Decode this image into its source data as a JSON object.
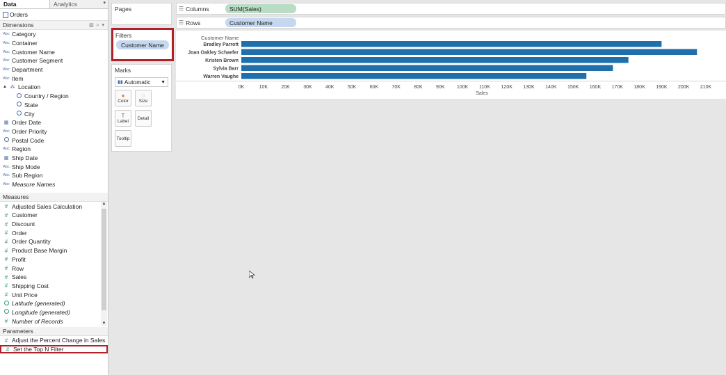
{
  "data_pane": {
    "tabs": [
      "Data",
      "Analytics"
    ],
    "datasource": "Orders",
    "dimensions_header": "Dimensions",
    "dimensions": [
      {
        "label": "Category",
        "type": "abc"
      },
      {
        "label": "Container",
        "type": "abc"
      },
      {
        "label": "Customer Name",
        "type": "abc"
      },
      {
        "label": "Customer Segment",
        "type": "abc"
      },
      {
        "label": "Department",
        "type": "abc"
      },
      {
        "label": "Item",
        "type": "abc"
      },
      {
        "label": "Location",
        "type": "hierarchy"
      },
      {
        "label": "Country / Region",
        "type": "geo",
        "level": 2
      },
      {
        "label": "State",
        "type": "geo",
        "level": 2
      },
      {
        "label": "City",
        "type": "geo",
        "level": 2
      },
      {
        "label": "Order Date",
        "type": "date"
      },
      {
        "label": "Order Priority",
        "type": "abc"
      },
      {
        "label": "Postal Code",
        "type": "geo"
      },
      {
        "label": "Region",
        "type": "abc"
      },
      {
        "label": "Ship Date",
        "type": "date"
      },
      {
        "label": "Ship Mode",
        "type": "abc"
      },
      {
        "label": "Sub Region",
        "type": "abc"
      },
      {
        "label": "Measure Names",
        "type": "abc",
        "italic": true
      }
    ],
    "measures_header": "Measures",
    "measures": [
      {
        "label": "Adjusted Sales Calculation",
        "type": "num"
      },
      {
        "label": "Customer",
        "type": "num"
      },
      {
        "label": "Discount",
        "type": "num"
      },
      {
        "label": "Order",
        "type": "num"
      },
      {
        "label": "Order Quantity",
        "type": "num"
      },
      {
        "label": "Product Base Margin",
        "type": "num"
      },
      {
        "label": "Profit",
        "type": "num"
      },
      {
        "label": "Row",
        "type": "num"
      },
      {
        "label": "Sales",
        "type": "num"
      },
      {
        "label": "Shipping Cost",
        "type": "num"
      },
      {
        "label": "Unit Price",
        "type": "num"
      },
      {
        "label": "Latitude (generated)",
        "type": "geo",
        "italic": true
      },
      {
        "label": "Longitude (generated)",
        "type": "geo",
        "italic": true
      },
      {
        "label": "Number of Records",
        "type": "num",
        "italic": true
      }
    ],
    "parameters_header": "Parameters",
    "parameters": [
      {
        "label": "Adjust the Percent Change in Sales",
        "type": "num"
      },
      {
        "label": "Set the Top N Filter",
        "type": "num",
        "highlighted": true
      }
    ]
  },
  "shelves": {
    "pages_label": "Pages",
    "filters_label": "Filters",
    "filter_pill": "Customer Name",
    "marks_label": "Marks",
    "marks_type": "Automatic",
    "marks_buttons": [
      {
        "label": "Color",
        "icon": "color-icon"
      },
      {
        "label": "Size",
        "icon": "size-icon"
      },
      {
        "label": "Label",
        "icon": "label-icon"
      },
      {
        "label": "Detail",
        "icon": "detail-icon"
      },
      {
        "label": "Tooltip",
        "icon": "tooltip-icon"
      }
    ],
    "columns_label": "Columns",
    "columns_pill": "SUM(Sales)",
    "rows_label": "Rows",
    "rows_pill": "Customer Name"
  },
  "chart_data": {
    "type": "bar",
    "orientation": "horizontal",
    "row_header": "Customer Name",
    "categories": [
      "Bradley Parrott",
      "Joan Oakley Schaefer",
      "Kristen Brown",
      "Sylvia Barr",
      "Warren Vaughe"
    ],
    "values": [
      190000,
      206000,
      175000,
      168000,
      156000
    ],
    "xlabel": "Sales",
    "xlim": [
      0,
      210000
    ],
    "ticks": [
      "0K",
      "10K",
      "20K",
      "30K",
      "40K",
      "50K",
      "60K",
      "70K",
      "80K",
      "90K",
      "100K",
      "110K",
      "120K",
      "130K",
      "140K",
      "150K",
      "160K",
      "170K",
      "180K",
      "190K",
      "200K",
      "210K"
    ],
    "bar_color": "#1f6fad"
  }
}
